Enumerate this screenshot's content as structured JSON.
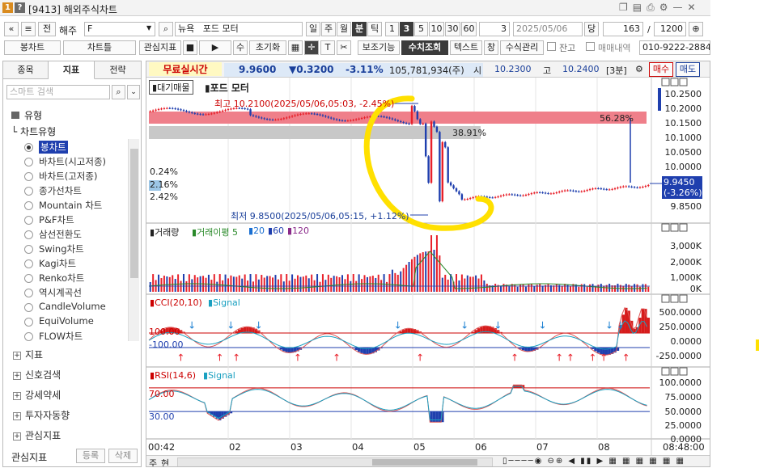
{
  "window": {
    "title": "[9413] 해외주식차트",
    "controls": [
      "❐",
      "▤",
      "⎙",
      "⚙",
      "—",
      "✕"
    ]
  },
  "toolbar1": {
    "prev": "«",
    "menu": "≡",
    "jeon": "전",
    "market": "해주",
    "code": "F",
    "stock_name": "포드 모터",
    "market_prefix": "뉴욕",
    "periods": [
      "일",
      "주",
      "월",
      "분",
      "틱"
    ],
    "period_selected": "분",
    "minutes": [
      "1",
      "3",
      "5",
      "10",
      "30",
      "60"
    ],
    "minute_selected": "3",
    "interval_value": "3",
    "date": "2025/05/06",
    "dang": "당",
    "count": "163",
    "total": "1200"
  },
  "toolbar2": {
    "labels": [
      "봉차트",
      "차트틀",
      "관심지표",
      "수",
      "초기화",
      "보조기능",
      "수치조회",
      "텍스트",
      "창",
      "수식관리",
      "잔고",
      "매매내역"
    ],
    "phone": "010-9222-2884-"
  },
  "left_panel": {
    "tabs": [
      "종목",
      "지표",
      "전략"
    ],
    "active_tab": "지표",
    "search_placeholder": "스마트 검색",
    "group_title": "유형",
    "subgroup": "차트유형",
    "chart_types": [
      "봉차트",
      "바차트(시고저종)",
      "바차트(고저종)",
      "종가선차트",
      "Mountain 차트",
      "P&F차트",
      "삼선전환도",
      "Swing차트",
      "Kagi차트",
      "Renko차트",
      "역시계곡선",
      "CandleVolume",
      "EquiVolume",
      "FLOW차트"
    ],
    "selected_type": "봉차트",
    "groups": [
      "지표",
      "신호검색",
      "강세약세",
      "투자자동향",
      "관심지표"
    ],
    "footer_label": "관심지표",
    "footer_btn1": "등록",
    "footer_btn2": "삭제"
  },
  "quote": {
    "realtime": "무료실시간",
    "price": "9.9600",
    "change": "▼0.3200",
    "pct": "-3.11%",
    "volume": "105,781,934(주)",
    "open_label": "시",
    "open": "10.2300",
    "high_label": "고",
    "high": "10.2400",
    "interval": "[3분]",
    "buy": "매수",
    "sell": "매도"
  },
  "price_pane": {
    "order_btn": "대기매물",
    "stock_name": "포드 모터",
    "high_note": "최고 10.2100(2025/05/06,05:03, -2.45%)",
    "low_note": "최저 9.8500(2025/05/06,05:15, +1.12%)",
    "pct_top": "56.28%",
    "pct_mid": "38.91%",
    "left_pcts": [
      "0.24%",
      "2.16%",
      "2.42%"
    ],
    "y_ticks": [
      "10.2500",
      "10.2000",
      "10.1500",
      "10.1000",
      "10.0500",
      "10.0000",
      "9.8500"
    ],
    "current_price": "9.9450",
    "current_pct": "(-3.26%)"
  },
  "volume_pane": {
    "title": "거래량",
    "ma_label": "거래이평",
    "ma_values": [
      "5",
      "20",
      "60",
      "120"
    ],
    "y_ticks": [
      "3,000K",
      "2,000K",
      "1,000K",
      "0K"
    ]
  },
  "cci_pane": {
    "title": "CCI(20,10)",
    "signal": "Signal",
    "levels": [
      "100.00",
      "-100.00"
    ],
    "y_ticks": [
      "500.0000",
      "250.0000",
      "0.0000",
      "-250.0000"
    ]
  },
  "rsi_pane": {
    "title": "RSI(14,6)",
    "signal": "Signal",
    "levels": [
      "70.00",
      "30.00"
    ],
    "y_ticks": [
      "100.0000",
      "75.0000",
      "50.0000",
      "25.0000",
      "0.0000"
    ]
  },
  "x_axis": {
    "labels": [
      "00:42",
      "02",
      "03",
      "04",
      "05",
      "06",
      "07",
      "08"
    ],
    "time": "08:48:00"
  },
  "bottom": {
    "left": "주",
    "mid": "현"
  },
  "colors": {
    "up": "#e8202a",
    "down": "#1f3fae",
    "band": "#ef7f8a",
    "highlight": "#ffe000"
  }
}
